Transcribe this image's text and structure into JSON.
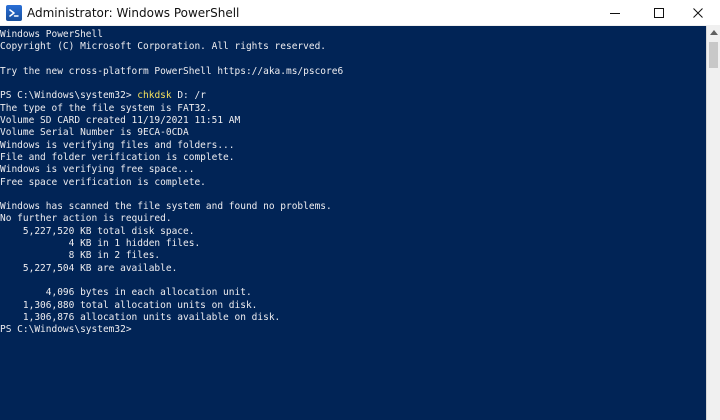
{
  "window": {
    "title": "Administrator: Windows PowerShell",
    "title_icon": "powershell-icon",
    "buttons": {
      "minimize": "minimize-icon",
      "maximize": "maximize-icon",
      "close": "close-icon"
    }
  },
  "terminal": {
    "lines": [
      "Windows PowerShell",
      "Copyright (C) Microsoft Corporation. All rights reserved.",
      "",
      "Try the new cross-platform PowerShell https://aka.ms/pscore6",
      "",
      "",
      "The type of the file system is FAT32.",
      "Volume SD CARD created 11/19/2021 11:51 AM",
      "Volume Serial Number is 9ECA-0CDA",
      "Windows is verifying files and folders...",
      "File and folder verification is complete.",
      "Windows is verifying free space...",
      "Free space verification is complete.",
      "",
      "Windows has scanned the file system and found no problems.",
      "No further action is required.",
      "    5,227,520 KB total disk space.",
      "            4 KB in 1 hidden files.",
      "            8 KB in 2 files.",
      "    5,227,504 KB are available.",
      "",
      "        4,096 bytes in each allocation unit.",
      "    1,306,880 total allocation units on disk.",
      "    1,306,876 allocation units available on disk.",
      "PS C:\\Windows\\system32>"
    ],
    "command": {
      "prompt": "PS C:\\Windows\\system32> ",
      "name": "chkdsk",
      "args": " D: /r"
    },
    "colors": {
      "background": "#012456",
      "text": "#eeedf0",
      "command": "#f4e05d"
    }
  },
  "scrollbar": {
    "icon": "scroll-up-arrow-icon"
  }
}
